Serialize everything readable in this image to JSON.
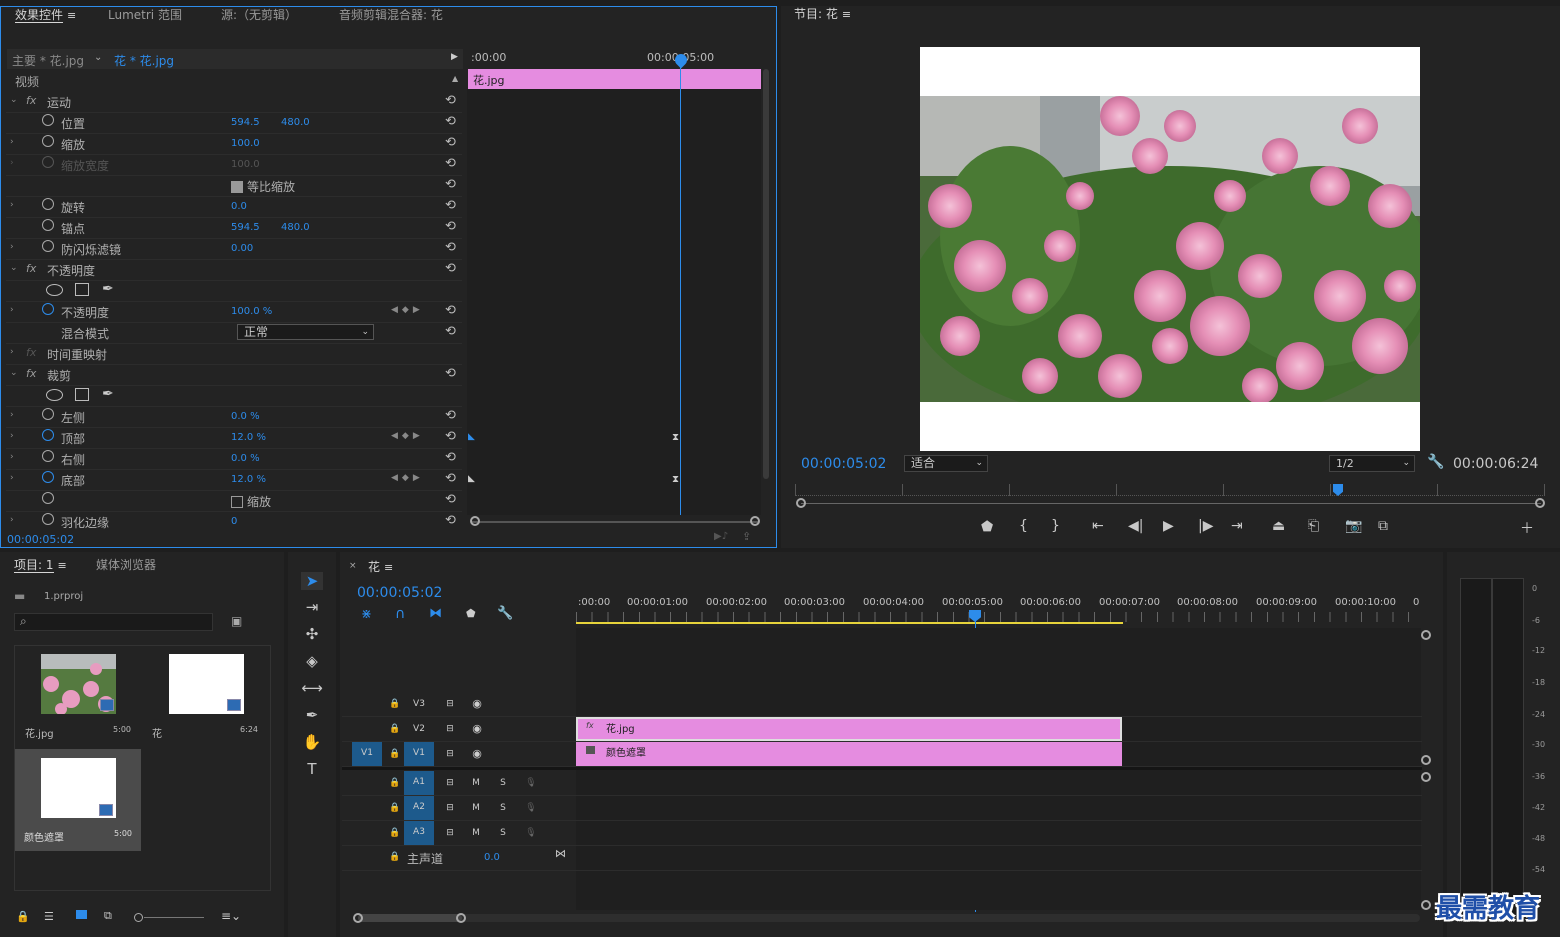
{
  "tabs_top_left": {
    "effects": "效果控件",
    "lumetri": "Lumetri 范围",
    "source": "源:（无剪辑）",
    "mixer": "音频剪辑混合器: 花"
  },
  "effects": {
    "master_clip": "主要 * 花.jpg",
    "clip": "花 * 花.jpg",
    "video_label": "视频",
    "timecode_start": ":00:00",
    "timecode_mid": "00:00:05:00",
    "clip_bar_label": "花.jpg",
    "footer_timecode": "00:00:05:02",
    "rows": [
      {
        "label": "运动",
        "type": "group"
      },
      {
        "label": "位置",
        "v1": "594.5",
        "v2": "480.0"
      },
      {
        "label": "缩放",
        "v1": "100.0"
      },
      {
        "label": "缩放宽度",
        "v1": "100.0"
      },
      {
        "label": "等比缩放",
        "type": "check"
      },
      {
        "label": "旋转",
        "v1": "0.0"
      },
      {
        "label": "锚点",
        "v1": "594.5",
        "v2": "480.0"
      },
      {
        "label": "防闪烁滤镜",
        "v1": "0.00"
      },
      {
        "label": "不透明度",
        "type": "group"
      },
      {
        "label": "不透明度",
        "v1": "100.0 %"
      },
      {
        "label": "混合模式",
        "select": "正常"
      },
      {
        "label": "时间重映射",
        "type": "group"
      },
      {
        "label": "裁剪",
        "type": "group"
      },
      {
        "label": "左侧",
        "v1": "0.0 %"
      },
      {
        "label": "顶部",
        "v1": "12.0 %"
      },
      {
        "label": "右侧",
        "v1": "0.0 %"
      },
      {
        "label": "底部",
        "v1": "12.0 %"
      },
      {
        "label": "缩放",
        "type": "check"
      },
      {
        "label": "羽化边缘",
        "v1": "0"
      }
    ]
  },
  "program": {
    "title": "节目: 花",
    "timecode": "00:00:05:02",
    "fit": "适合",
    "quality": "1/2",
    "duration": "00:00:06:24"
  },
  "project": {
    "tab": "项目: 1",
    "media_browser": "媒体浏览器",
    "file": "1.prproj",
    "items": [
      {
        "name": "花.jpg",
        "dur": "5:00"
      },
      {
        "name": "花",
        "dur": "6:24"
      },
      {
        "name": "颜色遮罩",
        "dur": "5:00"
      }
    ]
  },
  "timeline": {
    "tab": "花",
    "timecode": "00:00:05:02",
    "ticks": [
      ":00:00",
      "00:00:01:00",
      "00:00:02:00",
      "00:00:03:00",
      "00:00:04:00",
      "00:00:05:00",
      "00:00:06:00",
      "00:00:07:00",
      "00:00:08:00",
      "00:00:09:00",
      "00:00:10:00",
      "0"
    ],
    "tracks": {
      "v3": "V3",
      "v2": "V2",
      "v1": "V1",
      "src_v1": "V1",
      "a1": "A1",
      "a2": "A2",
      "a3": "A3",
      "m": "M",
      "s": "S"
    },
    "master": "主声道",
    "master_val": "0.0",
    "clip_v2": "花.jpg",
    "clip_v1": "颜色遮罩"
  },
  "meter": [
    "0",
    "-6",
    "-12",
    "-18",
    "-24",
    "-30",
    "-36",
    "-42",
    "-48",
    "-54"
  ],
  "watermark": "最需教育"
}
